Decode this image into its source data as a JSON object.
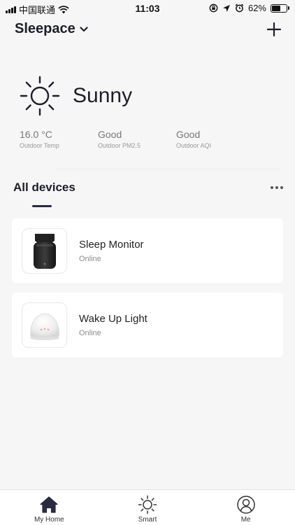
{
  "status_bar": {
    "carrier": "中国联通",
    "time": "11:03",
    "battery_percent": "62%",
    "battery_level": 0.62
  },
  "header": {
    "home_name": "Sleepace"
  },
  "weather": {
    "condition": "Sunny",
    "icon": "sun-icon",
    "stats": [
      {
        "value": "16.0 °C",
        "label": "Outdoor Temp"
      },
      {
        "value": "Good",
        "label": "Outdoor PM2.5"
      },
      {
        "value": "Good",
        "label": "Outdoor AQI"
      }
    ]
  },
  "devices_section": {
    "title": "All devices"
  },
  "devices": [
    {
      "name": "Sleep Monitor",
      "status": "Online",
      "icon": "sleep-monitor-image"
    },
    {
      "name": "Wake Up Light",
      "status": "Online",
      "icon": "wake-up-light-image"
    }
  ],
  "bottom_nav": [
    {
      "label": "My Home",
      "icon": "home-icon",
      "active": true
    },
    {
      "label": "Smart",
      "icon": "sun-icon",
      "active": false
    },
    {
      "label": "Me",
      "icon": "user-icon",
      "active": false
    }
  ],
  "colors": {
    "background": "#f6f6f6",
    "card": "#ffffff",
    "accent": "#2a2a40",
    "secondary_text": "#8a8a8a"
  }
}
